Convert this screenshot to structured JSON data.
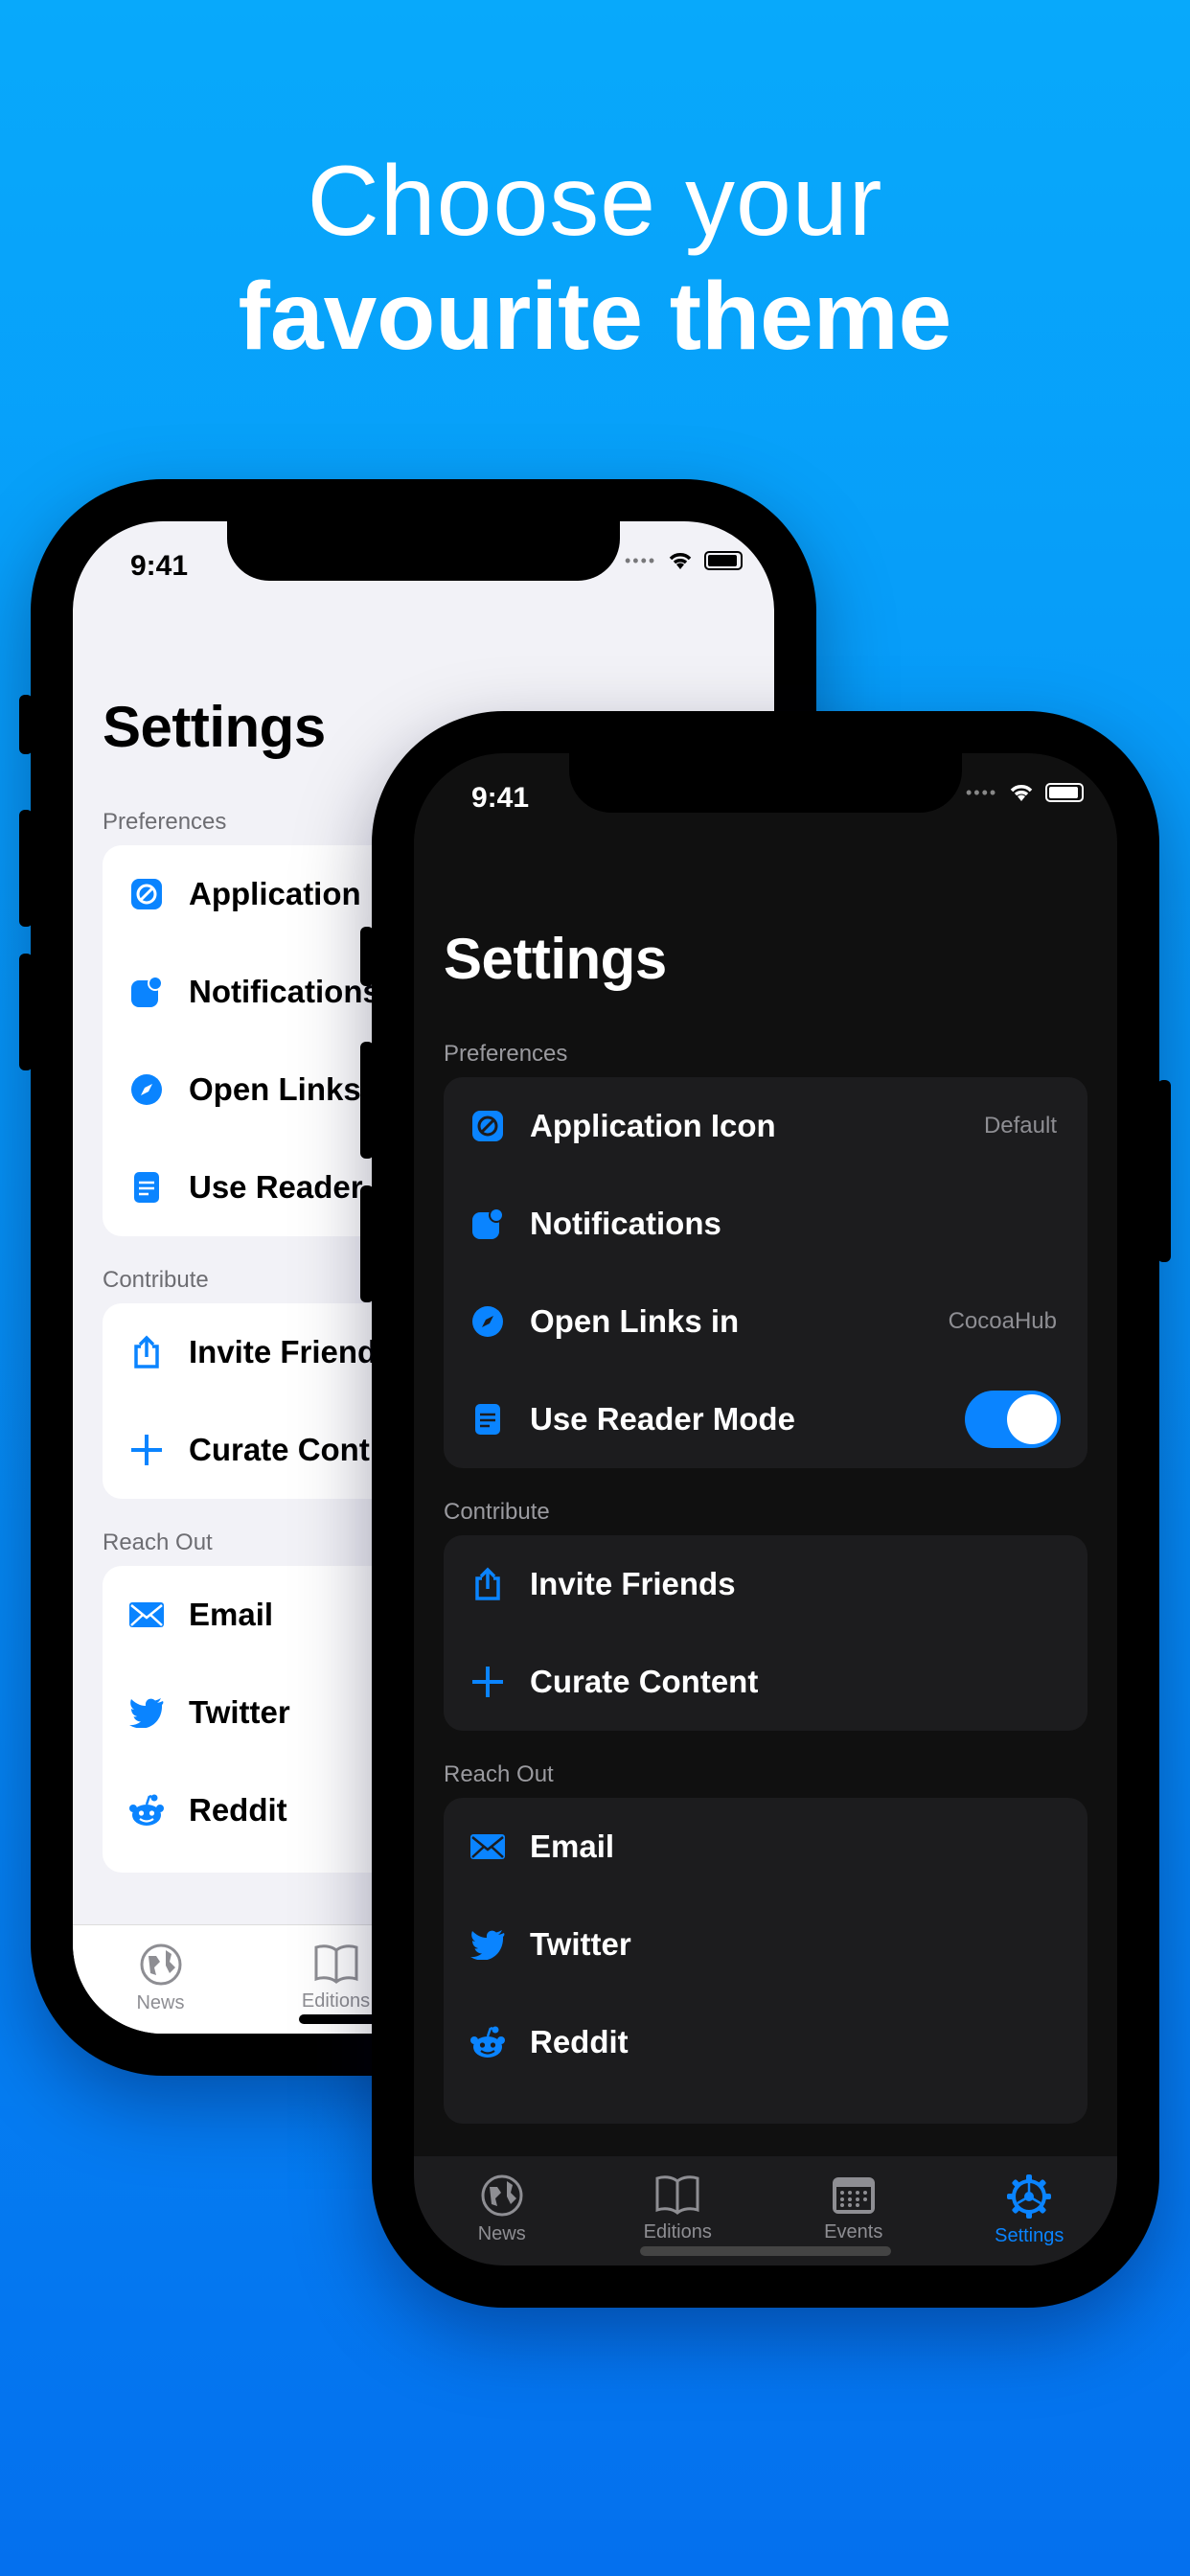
{
  "headline": {
    "line1": "Choose your",
    "line2": "favourite theme"
  },
  "colors": {
    "accent": "#0a84ff",
    "background_top": "#08a9fb",
    "background_bottom": "#0470ee"
  },
  "status_bar": {
    "time": "9:41"
  },
  "light_phone": {
    "title": "Settings",
    "sections": {
      "preferences": "Preferences",
      "contribute": "Contribute",
      "reach_out": "Reach Out"
    },
    "preferences": [
      {
        "label": "Application I",
        "icon": "app-icon"
      },
      {
        "label": "Notifications",
        "icon": "notifications-icon"
      },
      {
        "label": "Open Links i",
        "icon": "compass-icon"
      },
      {
        "label": "Use Reader",
        "icon": "reader-icon"
      }
    ],
    "contribute": [
      {
        "label": "Invite Friend",
        "icon": "share-icon"
      },
      {
        "label": "Curate Cont",
        "icon": "plus-icon"
      }
    ],
    "reach_out": [
      {
        "label": "Email",
        "icon": "mail-icon"
      },
      {
        "label": "Twitter",
        "icon": "twitter-icon"
      },
      {
        "label": "Reddit",
        "icon": "reddit-icon"
      }
    ],
    "tabs": [
      {
        "label": "News",
        "icon": "globe-icon"
      },
      {
        "label": "Editions",
        "icon": "book-icon"
      }
    ]
  },
  "dark_phone": {
    "title": "Settings",
    "sections": {
      "preferences": "Preferences",
      "contribute": "Contribute",
      "reach_out": "Reach Out"
    },
    "preferences": [
      {
        "label": "Application Icon",
        "value": "Default",
        "icon": "app-icon"
      },
      {
        "label": "Notifications",
        "icon": "notifications-icon"
      },
      {
        "label": "Open Links in",
        "value": "CocoaHub",
        "icon": "compass-icon"
      },
      {
        "label": "Use Reader Mode",
        "toggle_on": true,
        "icon": "reader-icon"
      }
    ],
    "contribute": [
      {
        "label": "Invite Friends",
        "icon": "share-icon"
      },
      {
        "label": "Curate Content",
        "icon": "plus-icon"
      }
    ],
    "reach_out": [
      {
        "label": "Email",
        "icon": "mail-icon"
      },
      {
        "label": "Twitter",
        "icon": "twitter-icon"
      },
      {
        "label": "Reddit",
        "icon": "reddit-icon"
      }
    ],
    "tabs": [
      {
        "label": "News",
        "icon": "globe-icon"
      },
      {
        "label": "Editions",
        "icon": "book-icon"
      },
      {
        "label": "Events",
        "icon": "calendar-icon"
      },
      {
        "label": "Settings",
        "icon": "gear-icon",
        "active": true
      }
    ]
  }
}
